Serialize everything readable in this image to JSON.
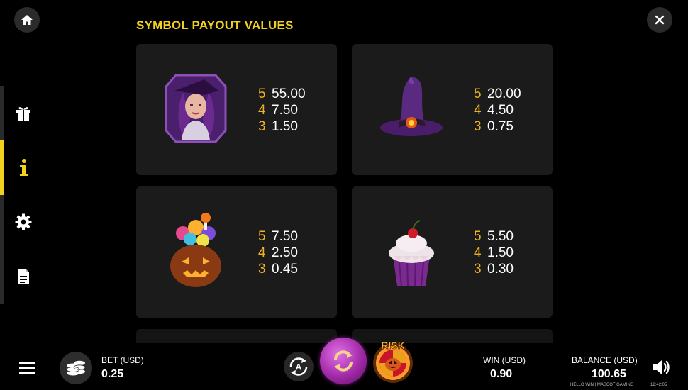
{
  "header": {
    "title": "SYMBOL PAYOUT VALUES"
  },
  "icons": {
    "home": "home-icon",
    "close": "close-icon",
    "gift": "gift-icon",
    "info": "info-icon",
    "settings": "gear-icon",
    "document": "document-icon"
  },
  "colors": {
    "accent": "#f2d21f",
    "count": "#f2b21f",
    "card_bg": "#1b1b1b"
  },
  "symbols": [
    {
      "name": "witch",
      "payouts": [
        {
          "count": "5",
          "value": "55.00"
        },
        {
          "count": "4",
          "value": "7.50"
        },
        {
          "count": "3",
          "value": "1.50"
        }
      ]
    },
    {
      "name": "witch hat",
      "payouts": [
        {
          "count": "5",
          "value": "20.00"
        },
        {
          "count": "4",
          "value": "4.50"
        },
        {
          "count": "3",
          "value": "0.75"
        }
      ]
    },
    {
      "name": "candy pumpkin",
      "payouts": [
        {
          "count": "5",
          "value": "7.50"
        },
        {
          "count": "4",
          "value": "2.50"
        },
        {
          "count": "3",
          "value": "0.45"
        }
      ]
    },
    {
      "name": "cupcake",
      "payouts": [
        {
          "count": "5",
          "value": "5.50"
        },
        {
          "count": "4",
          "value": "1.50"
        },
        {
          "count": "3",
          "value": "0.30"
        }
      ]
    }
  ],
  "footer": {
    "bet_label": "BET (USD)",
    "bet_value": "0.25",
    "win_label": "WIN (USD)",
    "win_value": "0.90",
    "balance_label": "BALANCE (USD)",
    "balance_value": "100.65",
    "risk_label": "RISK",
    "auto_label": "A",
    "credits": "HELLO WIN | MASCOT GAMING",
    "clock": "12:42:05"
  }
}
